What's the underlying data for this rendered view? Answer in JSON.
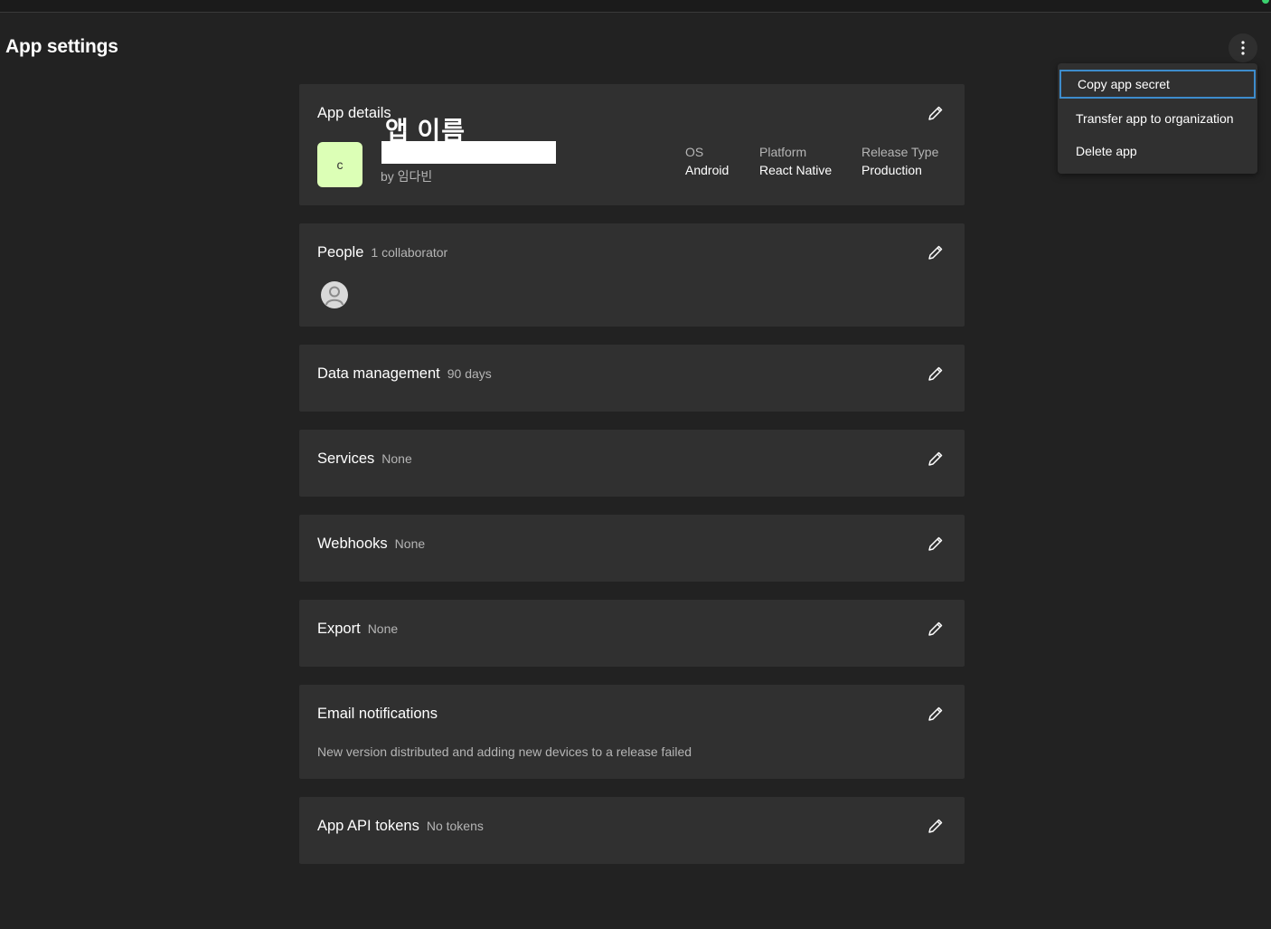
{
  "page": {
    "title": "App settings"
  },
  "menu": {
    "items": [
      {
        "label": "Copy app secret"
      },
      {
        "label": "Transfer app to organization"
      },
      {
        "label": "Delete app"
      }
    ]
  },
  "app_details": {
    "title": "App details",
    "app_name_overlay": "앱 이름",
    "avatar_letter": "c",
    "owner": "by 임다빈",
    "meta": [
      {
        "label": "OS",
        "value": "Android"
      },
      {
        "label": "Platform",
        "value": "React Native"
      },
      {
        "label": "Release Type",
        "value": "Production"
      }
    ]
  },
  "people": {
    "title": "People",
    "sub": "1 collaborator"
  },
  "data_management": {
    "title": "Data management",
    "sub": "90 days"
  },
  "services": {
    "title": "Services",
    "sub": "None"
  },
  "webhooks": {
    "title": "Webhooks",
    "sub": "None"
  },
  "export": {
    "title": "Export",
    "sub": "None"
  },
  "email_notifications": {
    "title": "Email notifications",
    "description": "New version distributed and adding new devices to a release failed"
  },
  "api_tokens": {
    "title": "App API tokens",
    "sub": "No tokens"
  },
  "colors": {
    "background": "#222222",
    "card": "#303030",
    "focus_outline": "#3d8ccc",
    "app_avatar": "#dcffb6"
  },
  "icons": [
    "more-vertical-icon",
    "pencil-icon",
    "user-silhouette-icon"
  ]
}
